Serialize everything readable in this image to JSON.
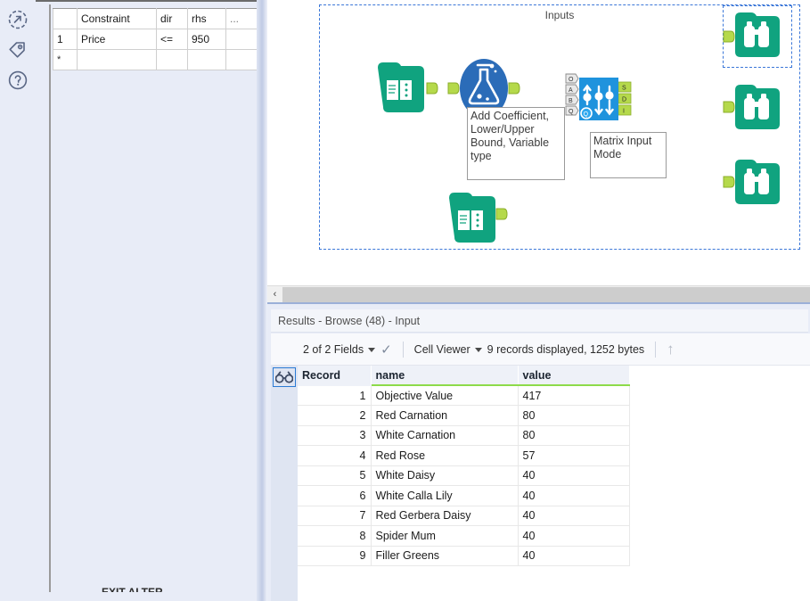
{
  "rail": {
    "icons": [
      {
        "name": "share-circle-icon",
        "title": "Share"
      },
      {
        "name": "tag-icon",
        "title": "Tag"
      },
      {
        "name": "help-question-icon",
        "title": "Help"
      }
    ]
  },
  "config_panel": {
    "grid": {
      "columns": [
        "",
        "Constraint",
        "dir",
        "rhs",
        "..."
      ],
      "rows": [
        {
          "num": "1",
          "constraint": "Price",
          "dir": "<=",
          "rhs": "950",
          "dots": ""
        }
      ],
      "new_row_marker": "*"
    },
    "bottom_cut_text": "EXIT ALTER"
  },
  "canvas": {
    "container_label": "Inputs",
    "annotations": [
      {
        "name": "add-coefficient-annotation",
        "text": "Add Coefficient, Lower/Upper Bound, Variable type"
      },
      {
        "name": "matrix-input-mode-annotation",
        "text": "Matrix Input Mode"
      }
    ],
    "nodes": [
      {
        "name": "input-data-node-1",
        "type": "input-book-icon",
        "label": ""
      },
      {
        "name": "input-data-node-2",
        "type": "input-book-icon",
        "label": ""
      },
      {
        "name": "optimization-node",
        "type": "flask-icon",
        "label": ""
      },
      {
        "name": "matrix-input-node",
        "type": "matrix-icon",
        "label": ""
      },
      {
        "name": "browse-node-1",
        "type": "binoculars-icon",
        "label": ""
      },
      {
        "name": "browse-node-2",
        "type": "binoculars-icon",
        "label": ""
      },
      {
        "name": "browse-node-3",
        "type": "binoculars-icon",
        "label": ""
      }
    ],
    "matrix_ports": {
      "inputs": [
        "O",
        "A",
        "B",
        "Q"
      ],
      "outputs": [
        "S",
        "D",
        "I"
      ]
    },
    "scrollbar": {
      "left_arrow": "‹"
    }
  },
  "results": {
    "header_title": "Results - Browse (48) - Input",
    "toolbar": {
      "fields_label": "2 of 2 Fields",
      "check_glyph": "✓",
      "viewer_label": "Cell Viewer",
      "records_label": "9 records displayed, 1252 bytes",
      "up_arrow": "↑"
    },
    "table": {
      "columns": [
        "Record",
        "name",
        "value"
      ],
      "rows": [
        {
          "record": "1",
          "name": "Objective Value",
          "value": "417"
        },
        {
          "record": "2",
          "name": "Red Carnation",
          "value": "80"
        },
        {
          "record": "3",
          "name": "White Carnation",
          "value": "80"
        },
        {
          "record": "4",
          "name": "Red Rose",
          "value": "57"
        },
        {
          "record": "5",
          "name": "White Daisy",
          "value": "40"
        },
        {
          "record": "6",
          "name": "White Calla Lily",
          "value": "40"
        },
        {
          "record": "7",
          "name": "Red Gerbera Daisy",
          "value": "40"
        },
        {
          "record": "8",
          "name": "Spider Mum",
          "value": "40"
        },
        {
          "record": "9",
          "name": "Filler Greens",
          "value": "40"
        }
      ]
    }
  },
  "colors": {
    "teal_node": "#10a37f",
    "blue_node": "#2b6cb8",
    "matrix_blue": "#1f93dd",
    "port_green": "#b5d94b",
    "selection_blue": "#3b77d8",
    "panel_bg": "#e8ecf7",
    "header_green_underline": "#8ddb4a",
    "wire_highlight": "#2a1fd4"
  }
}
